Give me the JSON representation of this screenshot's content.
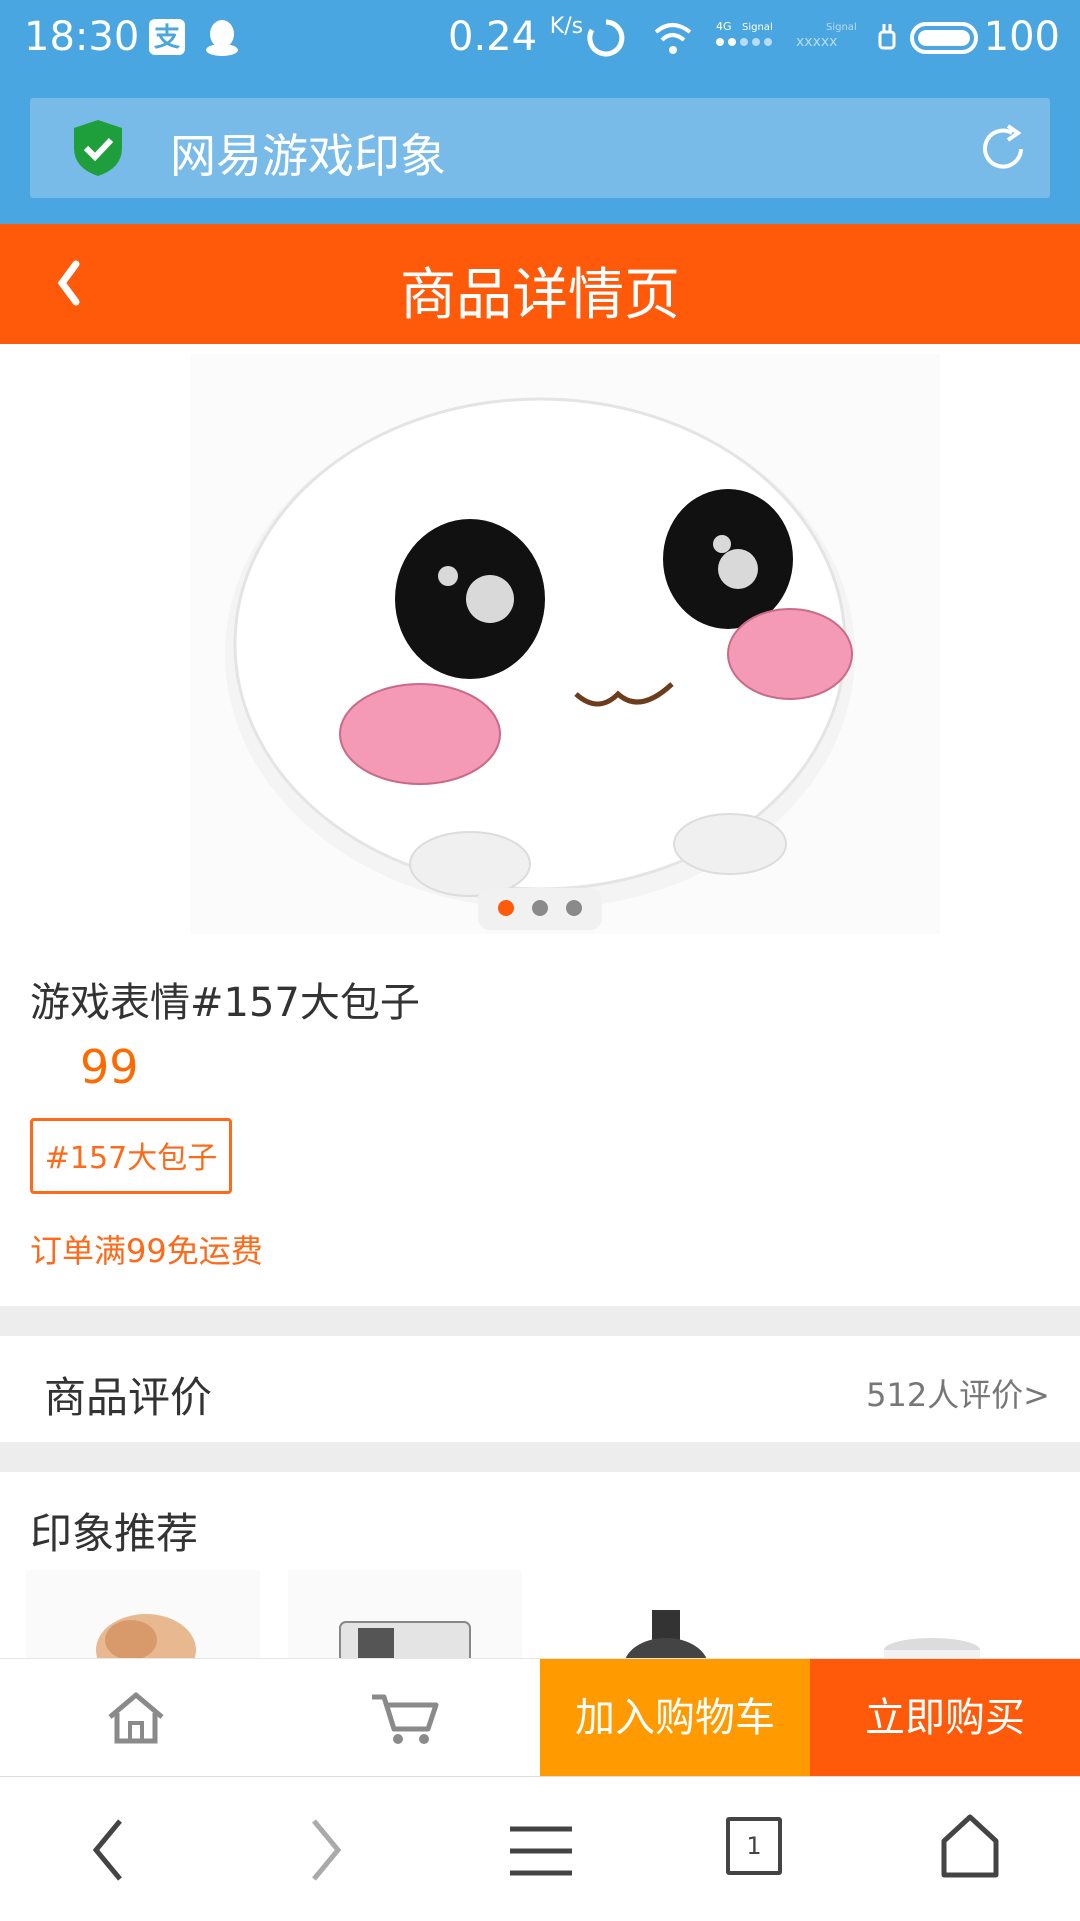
{
  "status": {
    "time": "18:30",
    "speed": "0.24",
    "speed_unit": "K/s",
    "signal_label": "Signal",
    "battery": "100"
  },
  "browser": {
    "page_title": "网易游戏印象"
  },
  "header": {
    "title": "商品详情页"
  },
  "product": {
    "name": "游戏表情#157大包子",
    "price": "99",
    "sku_tag": "#157大包子",
    "shipping_note": "订单满99免运费",
    "carousel_active": 0,
    "carousel_count": 3
  },
  "reviews": {
    "label": "商品评价",
    "count": "512人评价>"
  },
  "recommend": {
    "title": "印象推荐"
  },
  "actions": {
    "add_to_cart": "加入购物车",
    "buy_now": "立即购买"
  },
  "browser_nav": {
    "tab_count": "1"
  },
  "colors": {
    "status_blue": "#4aa6e1",
    "brand_orange": "#ff5a0a",
    "cart_orange": "#ff9a00"
  }
}
